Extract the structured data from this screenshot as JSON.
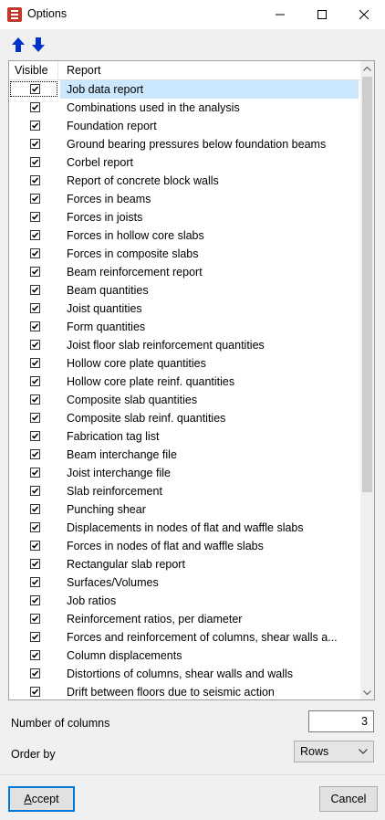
{
  "window": {
    "title": "Options",
    "icon": "app-logo-icon",
    "controls": [
      "minimize-icon",
      "maximize-icon",
      "close-icon"
    ]
  },
  "toolbar": {
    "icons": [
      "arrow-up-icon",
      "arrow-down-icon"
    ]
  },
  "list": {
    "columns": [
      "Visible",
      "Report"
    ],
    "selected_index": 0,
    "rows": [
      {
        "checked": true,
        "label": "Job data report"
      },
      {
        "checked": true,
        "label": "Combinations used in the analysis"
      },
      {
        "checked": true,
        "label": "Foundation report"
      },
      {
        "checked": true,
        "label": "Ground bearing pressures below foundation beams"
      },
      {
        "checked": true,
        "label": "Corbel report"
      },
      {
        "checked": true,
        "label": "Report of concrete block walls"
      },
      {
        "checked": true,
        "label": "Forces in beams"
      },
      {
        "checked": true,
        "label": "Forces in joists"
      },
      {
        "checked": true,
        "label": "Forces in hollow core slabs"
      },
      {
        "checked": true,
        "label": "Forces in composite slabs"
      },
      {
        "checked": true,
        "label": "Beam reinforcement report"
      },
      {
        "checked": true,
        "label": "Beam quantities"
      },
      {
        "checked": true,
        "label": "Joist quantities"
      },
      {
        "checked": true,
        "label": "Form quantities"
      },
      {
        "checked": true,
        "label": "Joist floor slab reinforcement quantities"
      },
      {
        "checked": true,
        "label": "Hollow core plate quantities"
      },
      {
        "checked": true,
        "label": "Hollow core plate reinf. quantities"
      },
      {
        "checked": true,
        "label": "Composite slab quantities"
      },
      {
        "checked": true,
        "label": "Composite slab reinf. quantities"
      },
      {
        "checked": true,
        "label": "Fabrication tag list"
      },
      {
        "checked": true,
        "label": "Beam interchange file"
      },
      {
        "checked": true,
        "label": "Joist interchange file"
      },
      {
        "checked": true,
        "label": "Slab reinforcement"
      },
      {
        "checked": true,
        "label": "Punching shear"
      },
      {
        "checked": true,
        "label": "Displacements in nodes of flat and waffle slabs"
      },
      {
        "checked": true,
        "label": "Forces in nodes of flat and waffle slabs"
      },
      {
        "checked": true,
        "label": "Rectangular slab report"
      },
      {
        "checked": true,
        "label": "Surfaces/Volumes"
      },
      {
        "checked": true,
        "label": "Job ratios"
      },
      {
        "checked": true,
        "label": "Reinforcement ratios, per diameter"
      },
      {
        "checked": true,
        "label": "Forces and reinforcement of columns, shear walls a..."
      },
      {
        "checked": true,
        "label": "Column displacements"
      },
      {
        "checked": true,
        "label": "Distortions of columns, shear walls and walls"
      },
      {
        "checked": true,
        "label": "Drift between floors due to seismic action"
      }
    ]
  },
  "settings": {
    "columns_label": "Number of columns",
    "columns_value": "3",
    "order_label": "Order by",
    "order_value": "Rows"
  },
  "buttons": {
    "accept": "Accept",
    "cancel": "Cancel"
  },
  "colors": {
    "selection": "#cce8ff",
    "accent": "#0078d7",
    "arrow": "#0033cc"
  }
}
